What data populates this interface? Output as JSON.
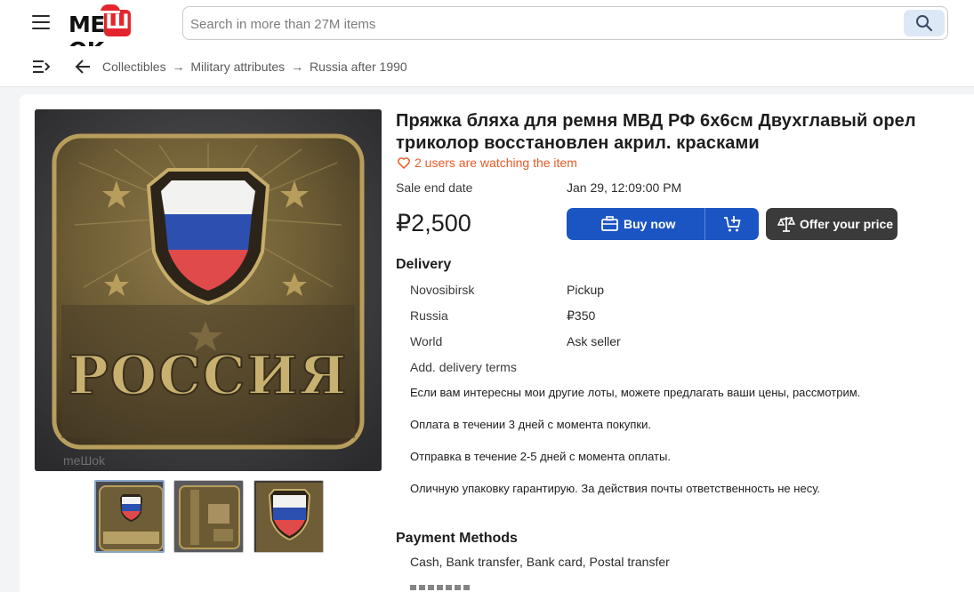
{
  "header": {
    "logo_text_left": "ME",
    "logo_box_letter": "Ш",
    "logo_text_right": "OK",
    "search_placeholder": "Search in more than 27M items"
  },
  "breadcrumb": {
    "items": [
      "Collectibles",
      "Military attributes",
      "Russia after 1990"
    ],
    "separator": "→"
  },
  "item": {
    "title": "Пряжка бляха для ремня МВД РФ 6х6см Двухглавый орел триколор восстановлен акрил. красками",
    "watchers": "2 users are watching the item",
    "sale_end_label": "Sale end date",
    "sale_end_value": "Jan 29, 12:09:00 PM",
    "price": "₽2,500",
    "buy_now_label": "Buy now",
    "offer_label": "Offer your price",
    "photo_text": "РОССИЯ",
    "watermark": "meШok"
  },
  "delivery": {
    "heading": "Delivery",
    "rows": [
      {
        "region": "Novosibirsk",
        "value": "Pickup"
      },
      {
        "region": "Russia",
        "value": "₽350"
      },
      {
        "region": "World",
        "value": "Ask seller"
      }
    ],
    "terms_label": "Add. delivery terms",
    "terms": [
      "Если вам интересны мои другие лоты, можете предлагать ваши цены, рассмотрим.",
      "Оплата в течении 3 дней с момента покупки.",
      "Отправка в течение 2-5 дней с момента оплаты.",
      "Оличную упаковку гарантирую. За действия почты ответственность не несу."
    ]
  },
  "payment": {
    "heading": "Payment Methods",
    "methods": "Cash, Bank transfer, Bank card, Postal transfer"
  },
  "colors": {
    "brand_red": "#e3262d",
    "primary_blue": "#1b55c4",
    "offer_dark": "#3b3b3b",
    "watch_orange": "#e55a28"
  }
}
